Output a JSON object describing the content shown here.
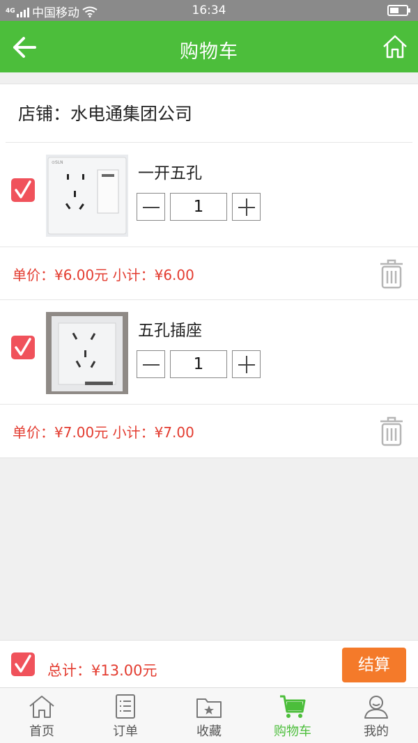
{
  "status_bar": {
    "carrier": "中国移动",
    "network": "4G",
    "time": "16:34"
  },
  "header": {
    "title": "购物车"
  },
  "shop": {
    "label": "店铺：水电通集团公司"
  },
  "items": [
    {
      "name": "一开五孔",
      "quantity": "1",
      "price_line": "单价：¥6.00元  小计：¥6.00",
      "checked": true
    },
    {
      "name": "五孔插座",
      "quantity": "1",
      "price_line": "单价：¥7.00元  小计：¥7.00",
      "checked": true
    }
  ],
  "footer": {
    "total": "总计：¥13.00元",
    "checkout_label": "结算",
    "all_checked": true
  },
  "tabs": [
    {
      "label": "首页",
      "icon": "home-icon"
    },
    {
      "label": "订单",
      "icon": "order-list-icon"
    },
    {
      "label": "收藏",
      "icon": "favorites-folder-icon"
    },
    {
      "label": "购物车",
      "icon": "cart-icon",
      "active": true
    },
    {
      "label": "我的",
      "icon": "user-icon"
    }
  ],
  "colors": {
    "brand_green": "#4cbe3b",
    "price_red": "#e33b2f",
    "checkbox_red": "#f0525b",
    "checkout_orange": "#f47a2a"
  }
}
